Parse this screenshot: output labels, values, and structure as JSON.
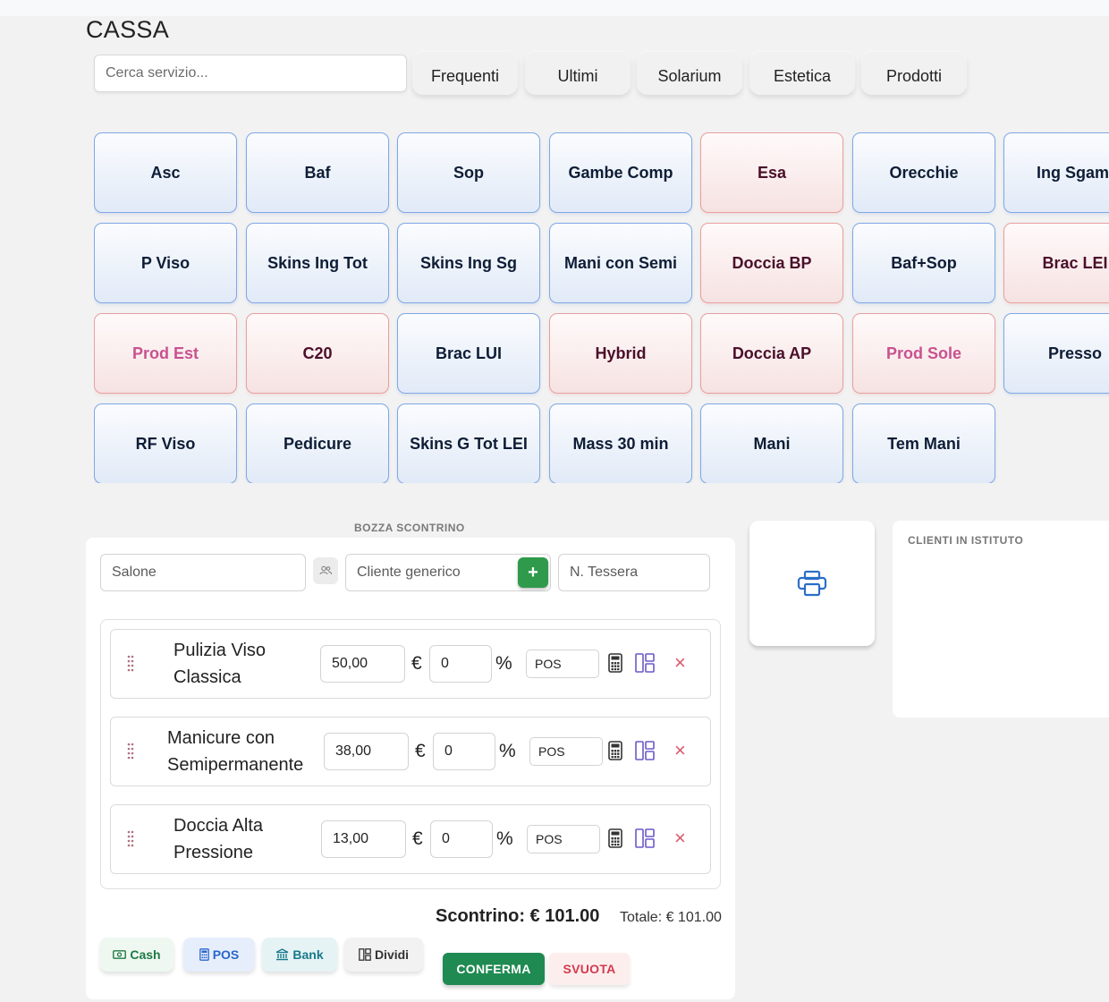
{
  "page": {
    "title": "CASSA"
  },
  "search": {
    "placeholder": "Cerca servizio..."
  },
  "tabs": [
    "Frequenti",
    "Ultimi",
    "Solarium",
    "Estetica",
    "Prodotti"
  ],
  "services": [
    [
      {
        "label": "Asc",
        "style": "blue"
      },
      {
        "label": "Baf",
        "style": "blue"
      },
      {
        "label": "Sop",
        "style": "blue"
      },
      {
        "label": "Gambe Comp",
        "style": "blue"
      },
      {
        "label": "Esa",
        "style": "pink"
      },
      {
        "label": "Orecchie",
        "style": "blue"
      },
      {
        "label": "Ing Sgaml",
        "style": "blue"
      }
    ],
    [
      {
        "label": "P Viso",
        "style": "blue"
      },
      {
        "label": "Skins Ing Tot",
        "style": "blue"
      },
      {
        "label": "Skins Ing Sg",
        "style": "blue"
      },
      {
        "label": "Mani con Semi",
        "style": "blue"
      },
      {
        "label": "Doccia BP",
        "style": "pink"
      },
      {
        "label": "Baf+Sop",
        "style": "blue"
      },
      {
        "label": "Brac LEI",
        "style": "pink"
      }
    ],
    [
      {
        "label": "Prod Est",
        "style": "prod"
      },
      {
        "label": "C20",
        "style": "pink"
      },
      {
        "label": "Brac LUI",
        "style": "blue"
      },
      {
        "label": "Hybrid",
        "style": "pink"
      },
      {
        "label": "Doccia AP",
        "style": "pink"
      },
      {
        "label": "Prod Sole",
        "style": "prod"
      },
      {
        "label": "Presso",
        "style": "blue"
      }
    ],
    [
      {
        "label": "RF Viso",
        "style": "blue"
      },
      {
        "label": "Pedicure",
        "style": "blue"
      },
      {
        "label": "Skins G Tot LEI",
        "style": "blue"
      },
      {
        "label": "Mass 30 min",
        "style": "blue"
      },
      {
        "label": "Mani",
        "style": "blue"
      },
      {
        "label": "Tem Mani",
        "style": "blue"
      }
    ]
  ],
  "draft": {
    "label": "BOZZA SCONTRINO",
    "salone_placeholder": "Salone",
    "cliente_placeholder": "Cliente generico",
    "tessera_placeholder": "N. Tessera",
    "plus_label": "+",
    "items": [
      {
        "name_line1": "Pulizia Viso",
        "name_line2": "Classica",
        "price": "50,00",
        "currency": "€",
        "discount": "0",
        "percent": "%",
        "payment": "POS",
        "remove": "×"
      },
      {
        "name_line1": "Manicure con",
        "name_line2": "Semipermanente",
        "price": "38,00",
        "currency": "€",
        "discount": "0",
        "percent": "%",
        "payment": "POS",
        "remove": "×"
      },
      {
        "name_line1": "Doccia Alta",
        "name_line2": "Pressione",
        "price": "13,00",
        "currency": "€",
        "discount": "0",
        "percent": "%",
        "payment": "POS",
        "remove": "×"
      }
    ],
    "scontrino": "Scontrino: € 101.00",
    "totale": "Totale: € 101.00",
    "pay_buttons": {
      "cash": "Cash",
      "pos": "POS",
      "bank": "Bank",
      "dividi": "Dividi"
    },
    "confirm_label": "CONFERMA",
    "clear_label": "SVUOTA"
  },
  "clienti": {
    "title": "CLIENTI IN ISTITUTO"
  },
  "colors": {
    "accent_green": "#2f9a4b",
    "confirm_green": "#1f8a52",
    "clear_red": "#d23b4e",
    "tile_blue_border": "#7fa7e6",
    "tile_pink_border": "#e89f9f",
    "print_blue": "#2a6ec8"
  }
}
